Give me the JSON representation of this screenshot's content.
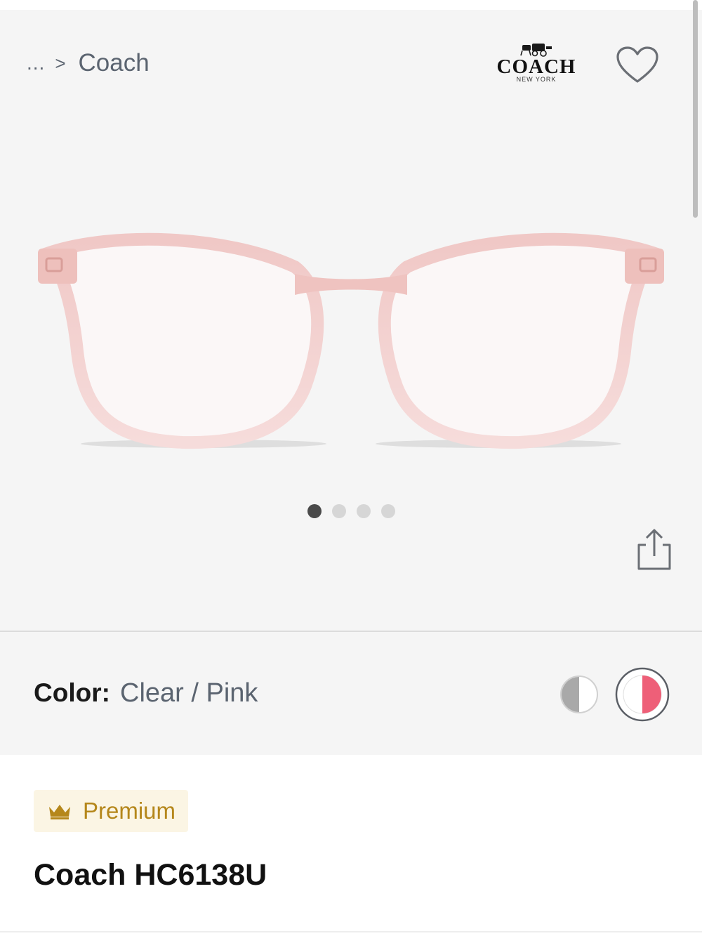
{
  "breadcrumb": {
    "ellipsis": "...",
    "separator": ">",
    "current": "Coach"
  },
  "brand": {
    "logo_text": "COACH",
    "logo_subtext": "NEW YORK",
    "logo_icon": "horse-carriage-icon"
  },
  "gallery": {
    "image_count": 4,
    "active_index": 0,
    "frame_color": "#f2cfcf"
  },
  "color_selector": {
    "label": "Color:",
    "value": "Clear / Pink",
    "swatches": [
      {
        "name": "Clear / Grey",
        "colors": [
          "#a9a9a9",
          "#ffffff"
        ],
        "selected": false
      },
      {
        "name": "Clear / Pink",
        "colors": [
          "#ffffff",
          "#ee5f78"
        ],
        "selected": true
      }
    ]
  },
  "badge": {
    "label": "Premium",
    "icon": "crown-icon",
    "color": "#b5871b",
    "background": "#fbf5e4"
  },
  "product": {
    "title": "Coach HC6138U"
  },
  "colors": {
    "hero_background": "#f5f5f5",
    "text_secondary": "#5b6470",
    "text_primary": "#111111"
  }
}
